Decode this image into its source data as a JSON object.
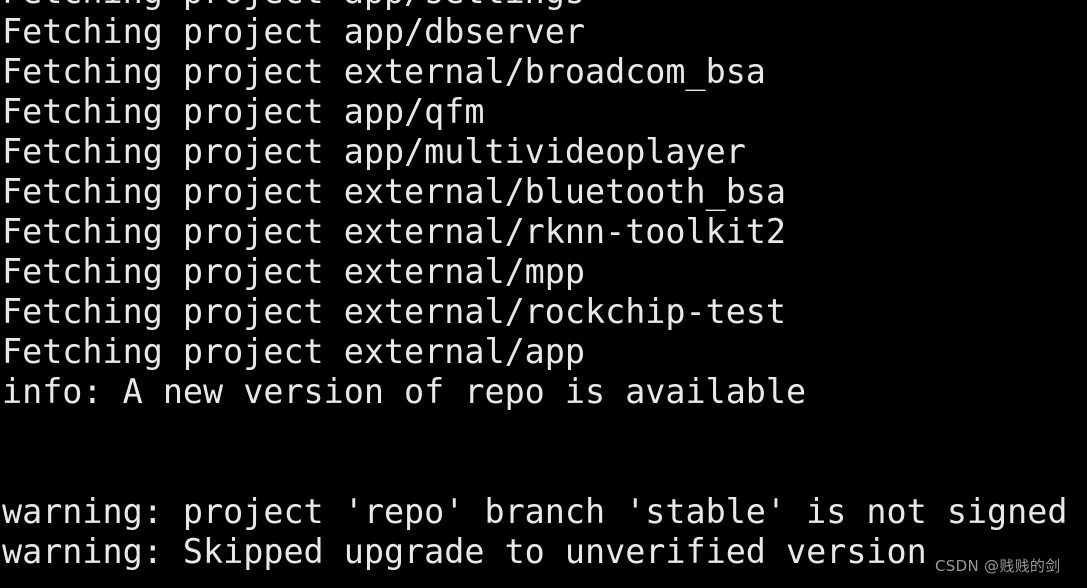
{
  "terminal": {
    "background_color": "#000000",
    "foreground_color": "#e8e8e8",
    "lines": [
      {
        "text": "Fetching project app/settings",
        "kind": "clipped-top"
      },
      {
        "text": "Fetching project app/dbserver",
        "kind": "output"
      },
      {
        "text": "Fetching project external/broadcom_bsa",
        "kind": "output"
      },
      {
        "text": "Fetching project app/qfm",
        "kind": "output"
      },
      {
        "text": "Fetching project app/multivideoplayer",
        "kind": "output"
      },
      {
        "text": "Fetching project external/bluetooth_bsa",
        "kind": "output"
      },
      {
        "text": "Fetching project external/rknn-toolkit2",
        "kind": "output"
      },
      {
        "text": "Fetching project external/mpp",
        "kind": "output"
      },
      {
        "text": "Fetching project external/rockchip-test",
        "kind": "output"
      },
      {
        "text": "Fetching project external/app",
        "kind": "output"
      },
      {
        "text": "info: A new version of repo is available",
        "kind": "info"
      },
      {
        "text": "",
        "kind": "blank"
      },
      {
        "text": "",
        "kind": "blank"
      },
      {
        "text": "warning: project 'repo' branch 'stable' is not signed",
        "kind": "warning"
      },
      {
        "text": "warning: Skipped upgrade to unverified version",
        "kind": "warning"
      }
    ]
  },
  "watermark": {
    "text": "CSDN @贱贱的剑",
    "color": "#9a9a9a"
  }
}
